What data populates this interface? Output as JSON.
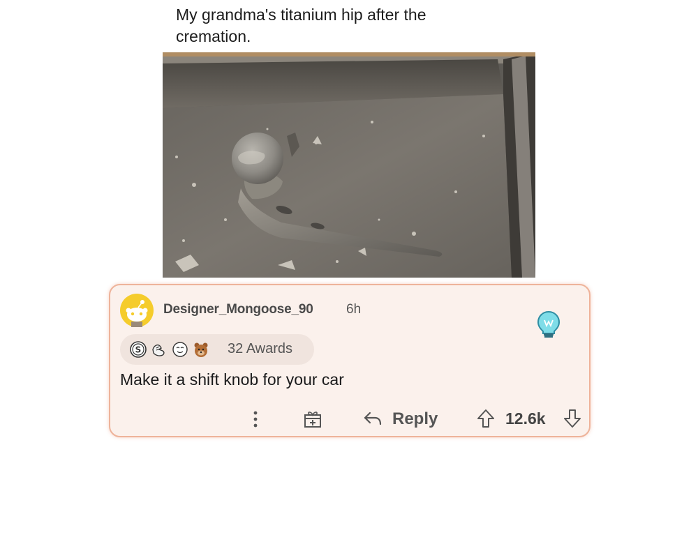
{
  "post": {
    "title": "My grandma's titanium hip after the cremation."
  },
  "comment": {
    "username": "Designer_Mongoose_90",
    "time": "6h",
    "awards_label": "32 Awards",
    "body": "Make it a shift knob for your car",
    "vote_count": "12.6k"
  },
  "actions": {
    "reply_label": "Reply"
  },
  "icons": {
    "avatar": "snoo-avatar-icon",
    "insight": "lightbulb-icon",
    "more": "more-options-icon",
    "gift": "gift-icon",
    "reply": "reply-arrow-icon",
    "upvote": "upvote-arrow-icon",
    "downvote": "downvote-arrow-icon"
  },
  "colors": {
    "card_background": "#fbf1ec",
    "card_border": "#eeb39a",
    "avatar_yellow": "#f5cc2b",
    "lightbulb": "#5fd0e0"
  }
}
